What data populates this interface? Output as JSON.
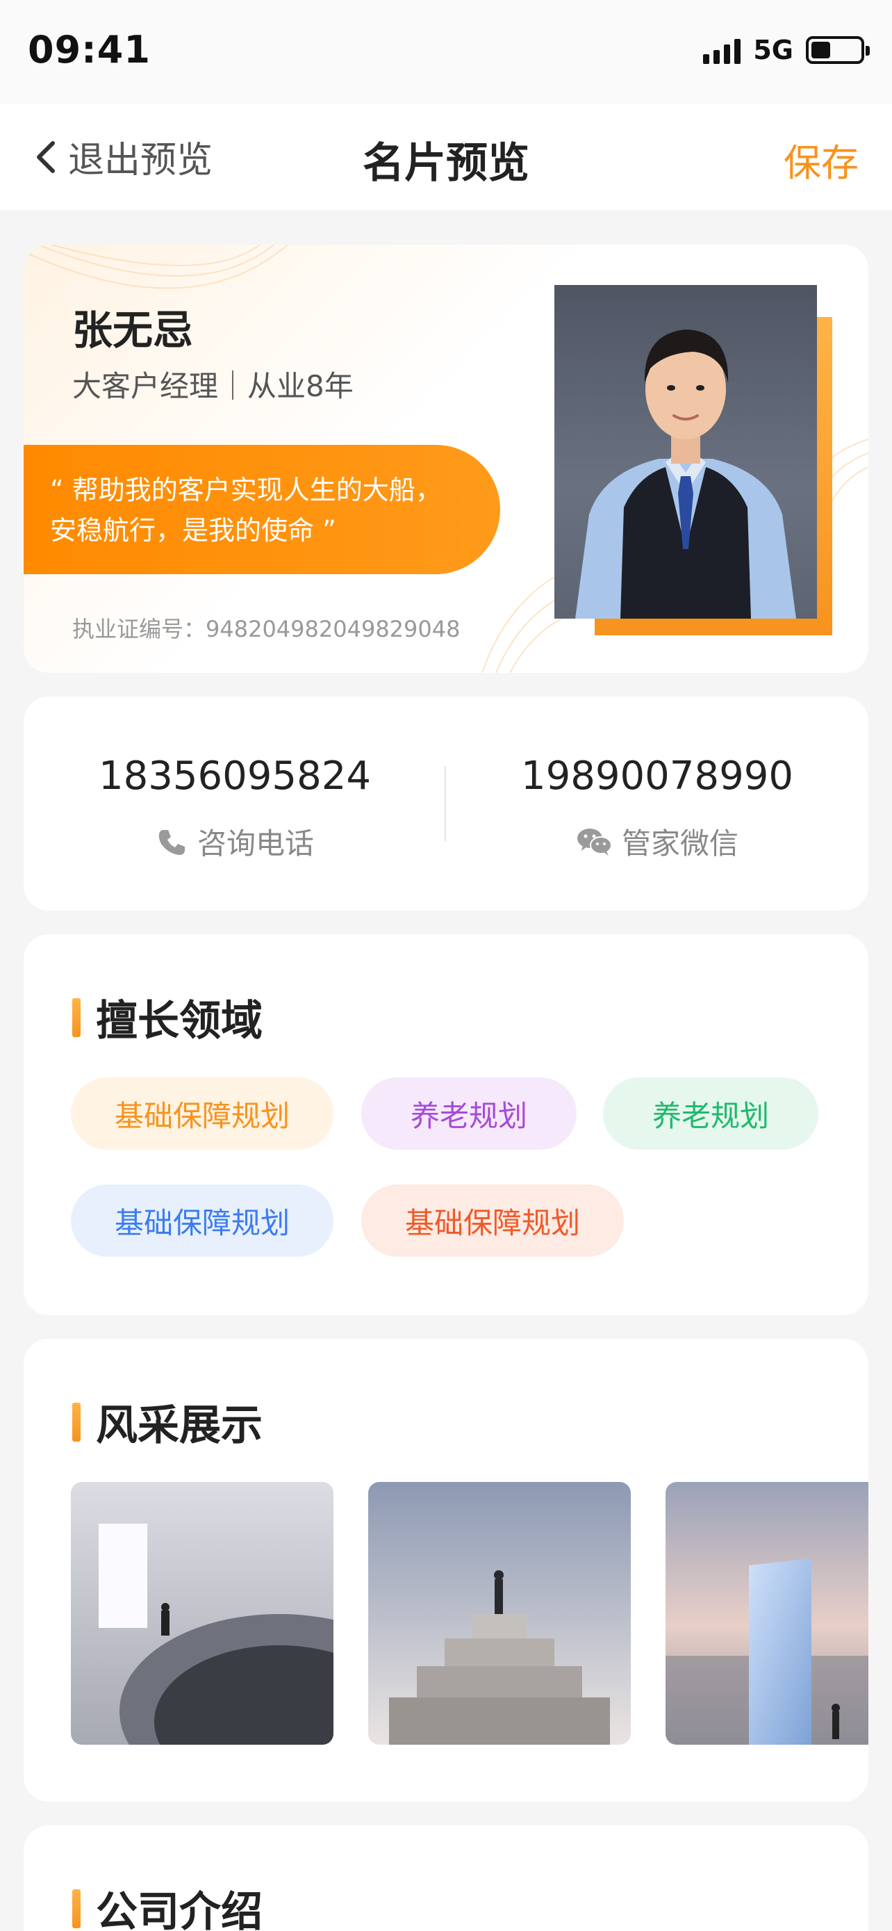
{
  "status_bar": {
    "time": "09:41",
    "network": "5G",
    "battery_level": 0.4,
    "signal_icon": "signal-bars-icon",
    "battery_icon": "battery-icon"
  },
  "nav": {
    "back_icon": "chevron-left-icon",
    "back_label": "退出预览",
    "title": "名片预览",
    "save_label": "保存"
  },
  "profile": {
    "name": "张无忌",
    "title": "大客户经理｜从业8年",
    "motto_line1": "“ 帮助我的客户实现人生的大船，",
    "motto_line2": "安稳航行，是我的使命 ”",
    "license": "执业证编号：948204982049829048"
  },
  "contacts": [
    {
      "number": "18356095824",
      "label": "咨询电话",
      "icon": "phone-icon"
    },
    {
      "number": "19890078990",
      "label": "管家微信",
      "icon": "wechat-icon"
    }
  ],
  "expertise": {
    "title": "擅长领域",
    "tags": [
      {
        "label": "基础保障规划",
        "color": "#f7931e",
        "bg": "#fff3e3"
      },
      {
        "label": "养老规划",
        "color": "#a64bd8",
        "bg": "#f6e9fc"
      },
      {
        "label": "养老规划",
        "color": "#1fba6b",
        "bg": "#e6f7ee"
      },
      {
        "label": "基础保障规划",
        "color": "#3c7cf0",
        "bg": "#e8f0fe"
      },
      {
        "label": "基础保障规划",
        "color": "#f05a2a",
        "bg": "#fdebe4"
      }
    ]
  },
  "gallery": {
    "title": "风采展示"
  },
  "company": {
    "title": "公司介绍"
  },
  "colors": {
    "accent": "#f7931e",
    "motto_bg": "#ff8a00"
  }
}
